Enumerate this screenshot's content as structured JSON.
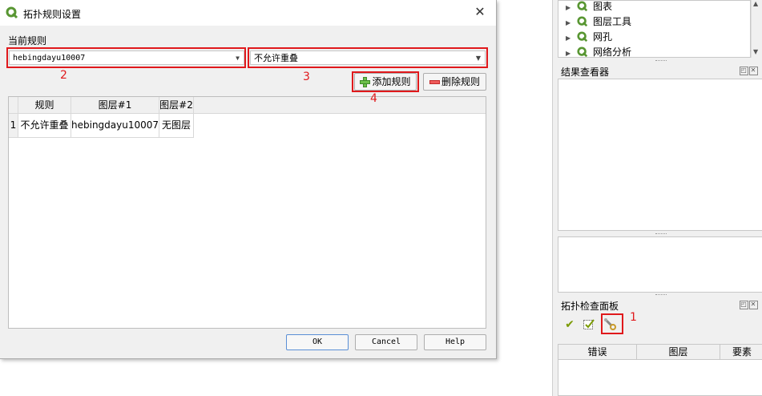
{
  "dialog": {
    "title": "拓扑规则设置",
    "current_rule_label": "当前规则",
    "layer_combo_value": "hebingdayu10007",
    "rule_combo_value": "不允许重叠",
    "add_rule_label": "添加规则",
    "delete_rule_label": "删除规则",
    "table": {
      "headers": [
        "规则",
        "图层#1",
        "图层#2"
      ],
      "rows": [
        {
          "index": "1",
          "rule": "不允许重叠",
          "layer1": "hebingdayu10007",
          "layer2": "无图层"
        }
      ]
    },
    "ok_label": "OK",
    "cancel_label": "Cancel",
    "help_label": "Help"
  },
  "annotations": {
    "n1": "1",
    "n2": "2",
    "n3": "3",
    "n4": "4",
    "color": "#e0191c"
  },
  "right_panel": {
    "tree_items": [
      "图表",
      "图层工具",
      "网孔",
      "网络分析"
    ],
    "result_viewer_title": "结果查看器",
    "topology_panel_title": "拓扑检查面板",
    "table_headers": [
      "错误",
      "图层",
      "要素"
    ]
  },
  "icons": {
    "qgis": "qgis-logo-icon",
    "close": "close-icon",
    "validate": "checkmark-icon",
    "validate_extent": "check-extent-icon",
    "configure": "wrench-icon"
  }
}
